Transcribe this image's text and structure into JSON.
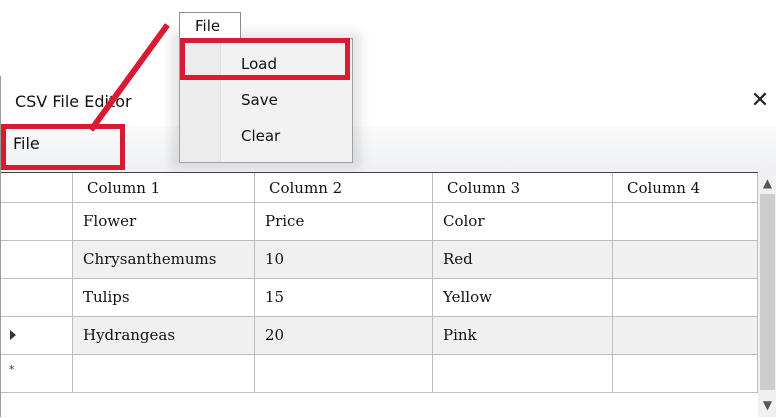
{
  "window": {
    "title": "CSV File Editor",
    "close_glyph": "✕"
  },
  "menubar": {
    "file_label": "File"
  },
  "file_menu": {
    "root_label": "File",
    "items": [
      {
        "label": "Load"
      },
      {
        "label": "Save"
      },
      {
        "label": "Clear"
      }
    ]
  },
  "grid": {
    "columns": [
      "Column 1",
      "Column 2",
      "Column 3",
      "Column 4"
    ],
    "rows": [
      [
        "Flower",
        "Price",
        "Color",
        ""
      ],
      [
        "Chrysanthemums",
        "10",
        "Red",
        ""
      ],
      [
        "Tulips",
        "15",
        "Yellow",
        ""
      ],
      [
        "Hydrangeas",
        "20",
        "Pink",
        ""
      ],
      [
        "",
        "",
        "",
        ""
      ]
    ],
    "row_markers": [
      "",
      "",
      "",
      "current-row-arrow-icon",
      "new-row-star-icon"
    ],
    "new_row_glyph": "*",
    "alt_row_color": "#f0f0f0"
  },
  "callout_color": "#d91a33"
}
